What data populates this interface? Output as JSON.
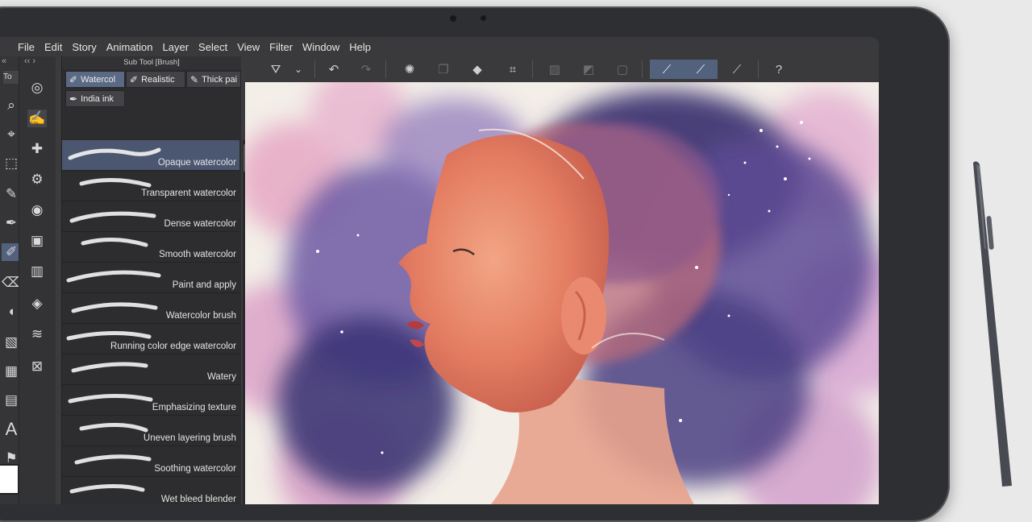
{
  "menu": {
    "items": [
      "File",
      "Edit",
      "Story",
      "Animation",
      "Layer",
      "Select",
      "View",
      "Filter",
      "Window",
      "Help"
    ]
  },
  "tool_panel": {
    "tab_label": "To",
    "tools": [
      "zoom-icon",
      "hand-icon",
      "operation-icon",
      "move-icon",
      "marquee-icon",
      "auto-select-icon",
      "eyedropper-icon",
      "pen-icon",
      "pencil-icon",
      "brush-icon",
      "airbrush-icon",
      "decoration-icon",
      "eraser-icon",
      "fill-icon",
      "gradient-icon",
      "figure-icon",
      "frame-icon",
      "text-icon",
      "balloon-icon"
    ]
  },
  "sub_tool": {
    "header": "Sub Tool [Brush]",
    "tabs": [
      {
        "label": "Watercol",
        "active": true
      },
      {
        "label": "Realistic",
        "active": false
      },
      {
        "label": "Thick pai",
        "active": false
      },
      {
        "label": "India ink",
        "active": false
      }
    ],
    "brushes": [
      {
        "name": "Opaque watercolor",
        "selected": true
      },
      {
        "name": "Transparent watercolor",
        "selected": false
      },
      {
        "name": "Dense watercolor",
        "selected": false
      },
      {
        "name": "Smooth watercolor",
        "selected": false
      },
      {
        "name": "Paint and apply",
        "selected": false
      },
      {
        "name": "Watercolor brush",
        "selected": false
      },
      {
        "name": "Running color edge watercolor",
        "selected": false
      },
      {
        "name": "Watery",
        "selected": false
      },
      {
        "name": "Emphasizing texture",
        "selected": false
      },
      {
        "name": "Uneven layering brush",
        "selected": false
      },
      {
        "name": "Soothing watercolor",
        "selected": false
      },
      {
        "name": "Wet bleed blender",
        "selected": false
      }
    ]
  },
  "command_bar": {
    "icons": [
      "fill-bucket-icon",
      "dropdown-chevron-icon",
      "undo-icon",
      "redo-icon",
      "clear-selection-icon",
      "copy-layer-icon",
      "fill-icon",
      "transform-icon",
      "hide-selection-icon",
      "reference-icon",
      "layer-mask-icon",
      "stroke-correct-icon",
      "brush-stroke-icon",
      "ruler-pen-icon",
      "help-icon"
    ]
  },
  "colors": {
    "menu_bg": "#3a3a3c",
    "panel_bg": "#2d2d2f",
    "selection": "#4b5670",
    "active_tab": "#5a6a85",
    "canvas_paper": "#f3eee8"
  }
}
